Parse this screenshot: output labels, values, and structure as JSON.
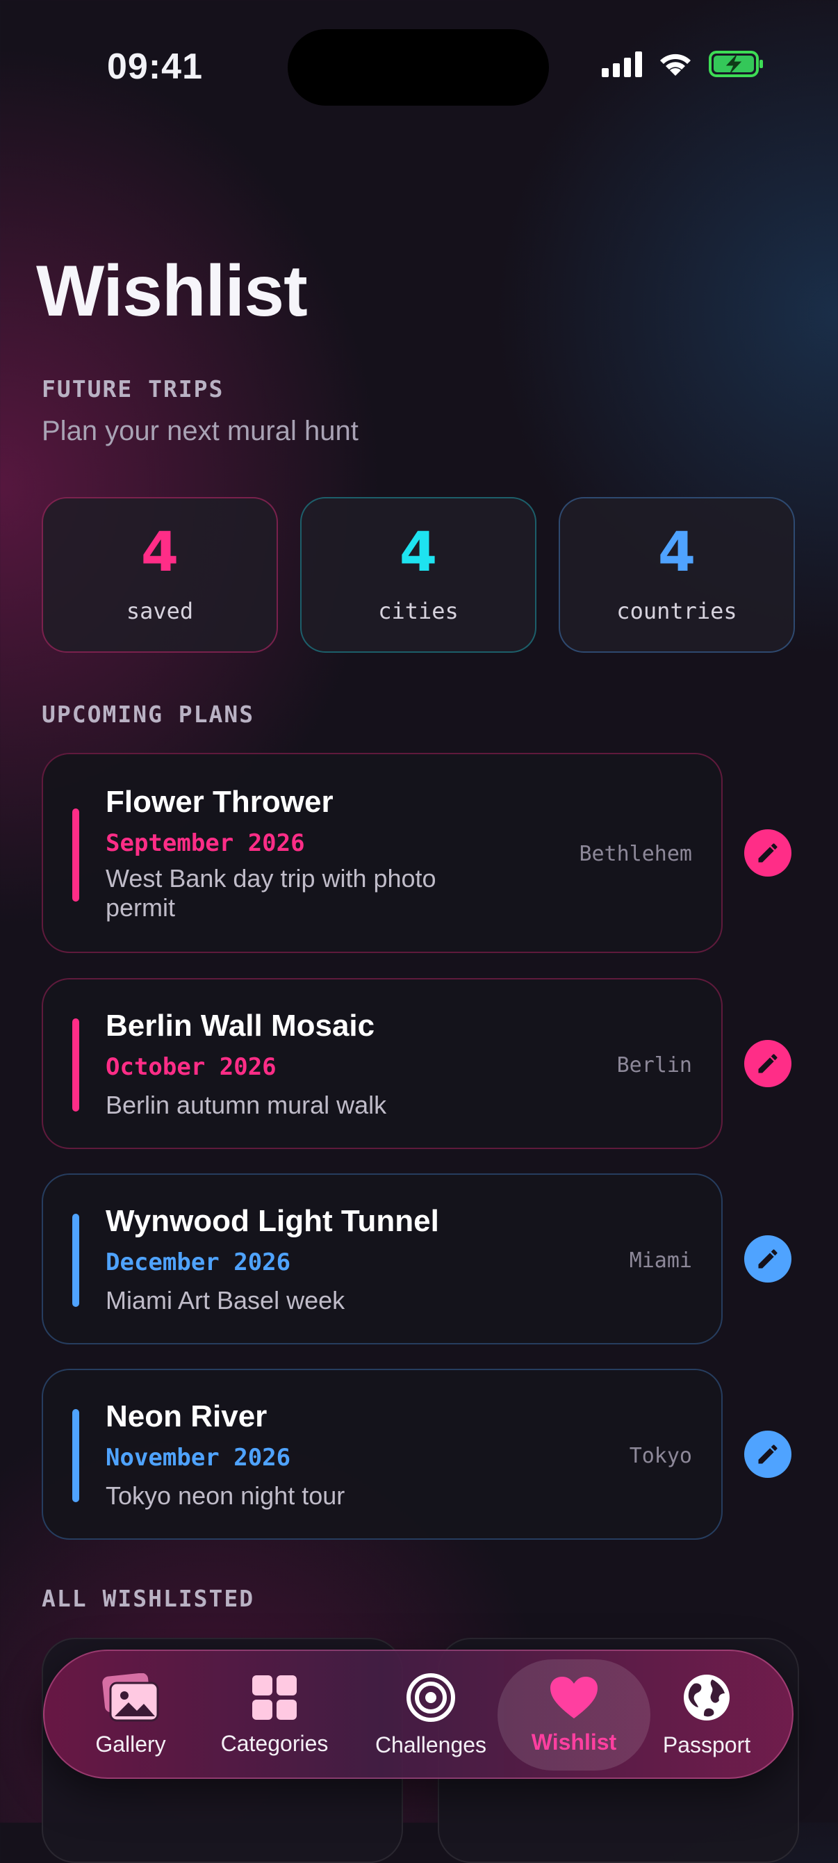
{
  "status_bar": {
    "time": "09:41"
  },
  "header": {
    "title": "Wishlist",
    "eyebrow": "FUTURE TRIPS",
    "subtitle": "Plan your next mural hunt"
  },
  "stats": [
    {
      "value": "4",
      "label": "saved",
      "color": "#ff2d87"
    },
    {
      "value": "4",
      "label": "cities",
      "color": "#1ee3f0"
    },
    {
      "value": "4",
      "label": "countries",
      "color": "#4fa3ff"
    }
  ],
  "sections": {
    "upcoming": "UPCOMING PLANS",
    "all": "ALL WISHLISTED"
  },
  "plans": [
    {
      "name": "Flower Thrower",
      "date": "September 2026",
      "note": "West Bank day trip with photo permit",
      "city": "Bethlehem",
      "accent": "#ff2d87"
    },
    {
      "name": "Berlin Wall Mosaic",
      "date": "October 2026",
      "note": "Berlin autumn mural walk",
      "city": "Berlin",
      "accent": "#ff2d87"
    },
    {
      "name": "Wynwood Light Tunnel",
      "date": "December 2026",
      "note": "Miami Art Basel week",
      "city": "Miami",
      "accent": "#4fa3ff"
    },
    {
      "name": "Neon River",
      "date": "November 2026",
      "note": "Tokyo neon night tour",
      "city": "Tokyo",
      "accent": "#4fa3ff"
    }
  ],
  "tabs": [
    {
      "label": "Gallery",
      "icon": "photos-icon"
    },
    {
      "label": "Categories",
      "icon": "grid-icon"
    },
    {
      "label": "Challenges",
      "icon": "target-icon"
    },
    {
      "label": "Wishlist",
      "icon": "heart-icon",
      "active": true
    },
    {
      "label": "Passport",
      "icon": "globe-icon"
    }
  ]
}
